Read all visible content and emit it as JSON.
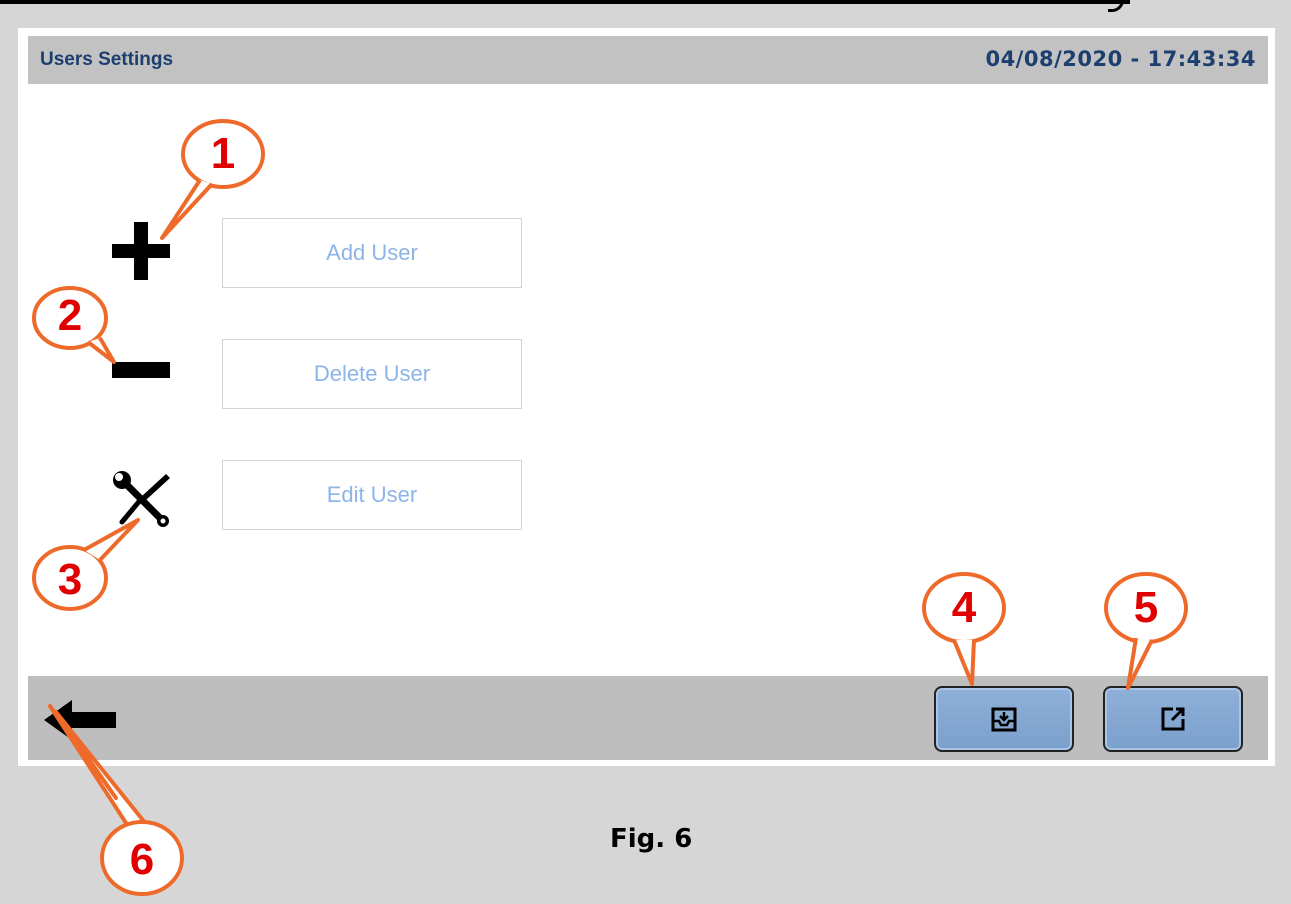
{
  "header": {
    "title": "Users Settings",
    "datetime": "04/08/2020 - 17:43:34"
  },
  "actions": [
    {
      "label": "Add User",
      "icon": "plus-icon"
    },
    {
      "label": "Delete User",
      "icon": "minus-icon"
    },
    {
      "label": "Edit User",
      "icon": "wrench-screwdriver-icon"
    }
  ],
  "toolbar": {
    "back_icon": "arrow-left-icon",
    "save_icon": "inbox-download-icon",
    "export_icon": "external-link-icon"
  },
  "callouts": [
    "1",
    "2",
    "3",
    "4",
    "5",
    "6"
  ],
  "caption": "Fig. 6",
  "colors": {
    "callout": "#e00000",
    "title_text": "#1d3f70",
    "button_text": "#8db4e8",
    "tool_button": "#8fb0d8"
  }
}
